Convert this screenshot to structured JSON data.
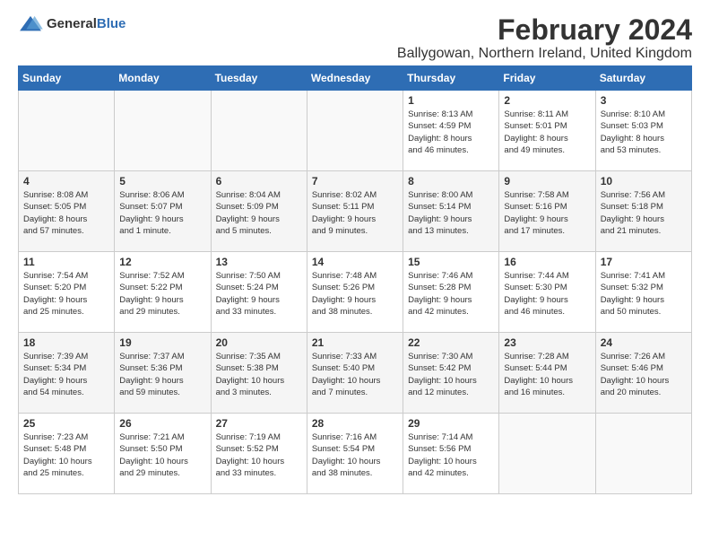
{
  "header": {
    "logo_general": "General",
    "logo_blue": "Blue",
    "title": "February 2024",
    "subtitle": "Ballygowan, Northern Ireland, United Kingdom"
  },
  "calendar": {
    "days_of_week": [
      "Sunday",
      "Monday",
      "Tuesday",
      "Wednesday",
      "Thursday",
      "Friday",
      "Saturday"
    ],
    "weeks": [
      [
        {
          "day": "",
          "info": ""
        },
        {
          "day": "",
          "info": ""
        },
        {
          "day": "",
          "info": ""
        },
        {
          "day": "",
          "info": ""
        },
        {
          "day": "1",
          "info": "Sunrise: 8:13 AM\nSunset: 4:59 PM\nDaylight: 8 hours\nand 46 minutes."
        },
        {
          "day": "2",
          "info": "Sunrise: 8:11 AM\nSunset: 5:01 PM\nDaylight: 8 hours\nand 49 minutes."
        },
        {
          "day": "3",
          "info": "Sunrise: 8:10 AM\nSunset: 5:03 PM\nDaylight: 8 hours\nand 53 minutes."
        }
      ],
      [
        {
          "day": "4",
          "info": "Sunrise: 8:08 AM\nSunset: 5:05 PM\nDaylight: 8 hours\nand 57 minutes."
        },
        {
          "day": "5",
          "info": "Sunrise: 8:06 AM\nSunset: 5:07 PM\nDaylight: 9 hours\nand 1 minute."
        },
        {
          "day": "6",
          "info": "Sunrise: 8:04 AM\nSunset: 5:09 PM\nDaylight: 9 hours\nand 5 minutes."
        },
        {
          "day": "7",
          "info": "Sunrise: 8:02 AM\nSunset: 5:11 PM\nDaylight: 9 hours\nand 9 minutes."
        },
        {
          "day": "8",
          "info": "Sunrise: 8:00 AM\nSunset: 5:14 PM\nDaylight: 9 hours\nand 13 minutes."
        },
        {
          "day": "9",
          "info": "Sunrise: 7:58 AM\nSunset: 5:16 PM\nDaylight: 9 hours\nand 17 minutes."
        },
        {
          "day": "10",
          "info": "Sunrise: 7:56 AM\nSunset: 5:18 PM\nDaylight: 9 hours\nand 21 minutes."
        }
      ],
      [
        {
          "day": "11",
          "info": "Sunrise: 7:54 AM\nSunset: 5:20 PM\nDaylight: 9 hours\nand 25 minutes."
        },
        {
          "day": "12",
          "info": "Sunrise: 7:52 AM\nSunset: 5:22 PM\nDaylight: 9 hours\nand 29 minutes."
        },
        {
          "day": "13",
          "info": "Sunrise: 7:50 AM\nSunset: 5:24 PM\nDaylight: 9 hours\nand 33 minutes."
        },
        {
          "day": "14",
          "info": "Sunrise: 7:48 AM\nSunset: 5:26 PM\nDaylight: 9 hours\nand 38 minutes."
        },
        {
          "day": "15",
          "info": "Sunrise: 7:46 AM\nSunset: 5:28 PM\nDaylight: 9 hours\nand 42 minutes."
        },
        {
          "day": "16",
          "info": "Sunrise: 7:44 AM\nSunset: 5:30 PM\nDaylight: 9 hours\nand 46 minutes."
        },
        {
          "day": "17",
          "info": "Sunrise: 7:41 AM\nSunset: 5:32 PM\nDaylight: 9 hours\nand 50 minutes."
        }
      ],
      [
        {
          "day": "18",
          "info": "Sunrise: 7:39 AM\nSunset: 5:34 PM\nDaylight: 9 hours\nand 54 minutes."
        },
        {
          "day": "19",
          "info": "Sunrise: 7:37 AM\nSunset: 5:36 PM\nDaylight: 9 hours\nand 59 minutes."
        },
        {
          "day": "20",
          "info": "Sunrise: 7:35 AM\nSunset: 5:38 PM\nDaylight: 10 hours\nand 3 minutes."
        },
        {
          "day": "21",
          "info": "Sunrise: 7:33 AM\nSunset: 5:40 PM\nDaylight: 10 hours\nand 7 minutes."
        },
        {
          "day": "22",
          "info": "Sunrise: 7:30 AM\nSunset: 5:42 PM\nDaylight: 10 hours\nand 12 minutes."
        },
        {
          "day": "23",
          "info": "Sunrise: 7:28 AM\nSunset: 5:44 PM\nDaylight: 10 hours\nand 16 minutes."
        },
        {
          "day": "24",
          "info": "Sunrise: 7:26 AM\nSunset: 5:46 PM\nDaylight: 10 hours\nand 20 minutes."
        }
      ],
      [
        {
          "day": "25",
          "info": "Sunrise: 7:23 AM\nSunset: 5:48 PM\nDaylight: 10 hours\nand 25 minutes."
        },
        {
          "day": "26",
          "info": "Sunrise: 7:21 AM\nSunset: 5:50 PM\nDaylight: 10 hours\nand 29 minutes."
        },
        {
          "day": "27",
          "info": "Sunrise: 7:19 AM\nSunset: 5:52 PM\nDaylight: 10 hours\nand 33 minutes."
        },
        {
          "day": "28",
          "info": "Sunrise: 7:16 AM\nSunset: 5:54 PM\nDaylight: 10 hours\nand 38 minutes."
        },
        {
          "day": "29",
          "info": "Sunrise: 7:14 AM\nSunset: 5:56 PM\nDaylight: 10 hours\nand 42 minutes."
        },
        {
          "day": "",
          "info": ""
        },
        {
          "day": "",
          "info": ""
        }
      ]
    ]
  }
}
